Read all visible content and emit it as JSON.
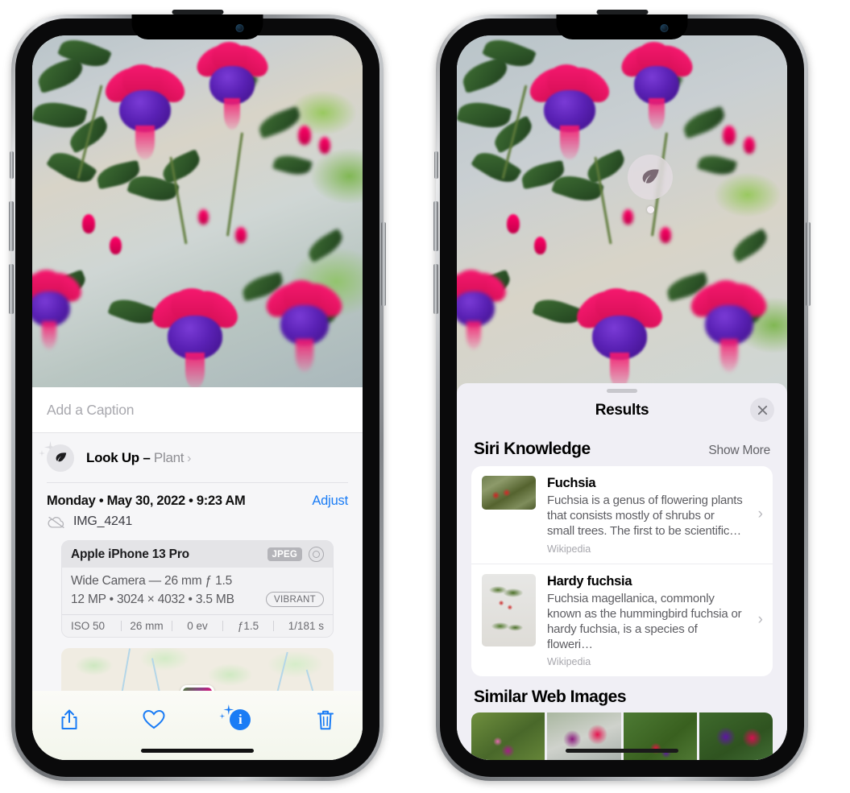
{
  "left_phone": {
    "caption": {
      "placeholder": "Add a Caption",
      "value": ""
    },
    "lookup": {
      "label": "Look Up",
      "dash": " – ",
      "subject": "Plant",
      "chevron": "›",
      "icon": "leaf-icon"
    },
    "meta": {
      "date": "Monday • May 30, 2022 • 9:23 AM",
      "adjust": "Adjust",
      "filename": "IMG_4241",
      "cloud_icon": "cloud-slash-icon"
    },
    "exif": {
      "device": "Apple iPhone 13 Pro",
      "format_badge": "JPEG",
      "lens_icon": "lens-target-icon",
      "line1": "Wide Camera — 26 mm ƒ 1.5",
      "line2": "12 MP • 3024 × 4032 • 3.5 MB",
      "style_badge": "VIBRANT",
      "stats": [
        "ISO 50",
        "26 mm",
        "0 ev",
        "ƒ1.5",
        "1/181 s"
      ]
    },
    "toolbar": [
      {
        "name": "share-button",
        "icon": "share-icon",
        "active": false
      },
      {
        "name": "favorite-button",
        "icon": "heart-icon",
        "active": false
      },
      {
        "name": "info-button",
        "icon": "sparkle-info-icon",
        "active": true
      },
      {
        "name": "delete-button",
        "icon": "trash-icon",
        "active": false
      }
    ],
    "colors": {
      "accent": "#1a7cf5",
      "sheet_bg": "#f6f6f8",
      "card_bg": "#efeff1"
    }
  },
  "right_phone": {
    "visual_lookup_badge": {
      "icon": "leaf-icon"
    },
    "sheet": {
      "title": "Results",
      "close_icon": "close-icon",
      "sections": [
        {
          "title": "Siri Knowledge",
          "action": "Show More",
          "results": [
            {
              "title": "Fuchsia",
              "description": "Fuchsia is a genus of flowering plants that consists mostly of shrubs or small trees. The first to be scientific…",
              "source": "Wikipedia",
              "thumb": "fuchsia-red-flowers-thumb",
              "chevron": "›"
            },
            {
              "title": "Hardy fuchsia",
              "description": "Fuchsia magellanica, commonly known as the hummingbird fuchsia or hardy fuchsia, is a species of floweri…",
              "source": "Wikipedia",
              "thumb": "hardy-fuchsia-specimen-thumb",
              "chevron": "›"
            }
          ]
        },
        {
          "title": "Similar Web Images",
          "images": [
            "fuchsia-pink-purple-bloom",
            "fuchsia-red-magenta-closeup",
            "fuchsia-hanging-basket",
            "fuchsia-purple-magenta-pair"
          ]
        }
      ]
    },
    "colors": {
      "sheet_bg": "#f0eff5",
      "card_bg": "#ffffff"
    }
  }
}
